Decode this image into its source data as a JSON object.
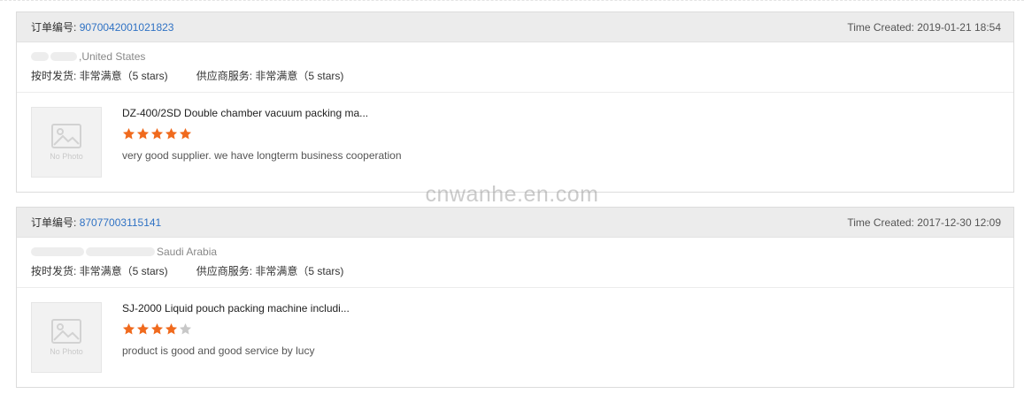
{
  "orders": [
    {
      "order_label": "订单编号:",
      "order_number": "9070042001021823",
      "time_label": "Time Created:",
      "time_value": "2019-01-21 18:54",
      "buyer_location": ",United States",
      "delivery_rating": "按时发货: 非常满意（5 stars)",
      "service_rating": "供应商服务: 非常满意（5 stars)",
      "photo_placeholder": "No Photo",
      "product_name": "DZ-400/2SD Double chamber vacuum packing ma...",
      "stars_rating": 5,
      "stars_max": 5,
      "review": "very good supplier. we have longterm business cooperation"
    },
    {
      "order_label": "订单编号:",
      "order_number": "87077003115141",
      "time_label": "Time Created:",
      "time_value": "2017-12-30 12:09",
      "buyer_location": "Saudi Arabia",
      "delivery_rating": "按时发货: 非常满意（5 stars)",
      "service_rating": "供应商服务: 非常满意（5 stars)",
      "photo_placeholder": "No Photo",
      "product_name": "SJ-2000 Liquid pouch packing machine includi...",
      "stars_rating": 4,
      "stars_max": 5,
      "review": "product is good and good service by lucy"
    }
  ],
  "watermark": "cnwanhe.en.com",
  "colors": {
    "star_filled": "#f06a1d",
    "star_empty": "#c8c8c8",
    "link": "#2f72c4",
    "header_bg": "#ececec"
  },
  "icons": {
    "photo_placeholder": "image-placeholder-icon",
    "star": "star-icon"
  }
}
